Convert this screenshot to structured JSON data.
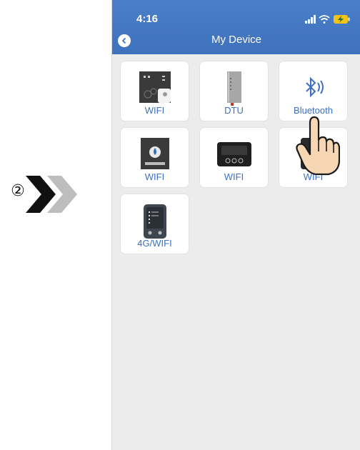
{
  "step": {
    "number": "②"
  },
  "status_bar": {
    "time": "4:16"
  },
  "header": {
    "title": "My Device"
  },
  "devices": [
    {
      "label": "WIFI",
      "icon": "control-panel-white"
    },
    {
      "label": "DTU",
      "icon": "dtu-module"
    },
    {
      "label": "Bluetooth",
      "icon": "bluetooth-icon"
    },
    {
      "label": "WIFI",
      "icon": "water-controller"
    },
    {
      "label": "WIFI",
      "icon": "display-controller"
    },
    {
      "label": "WIFI",
      "icon": "dark-panel"
    },
    {
      "label": "4G/WIFI",
      "icon": "4g-controller"
    }
  ],
  "colors": {
    "header": "#4177c2",
    "label": "#3d6fc4",
    "background": "#ececec"
  }
}
